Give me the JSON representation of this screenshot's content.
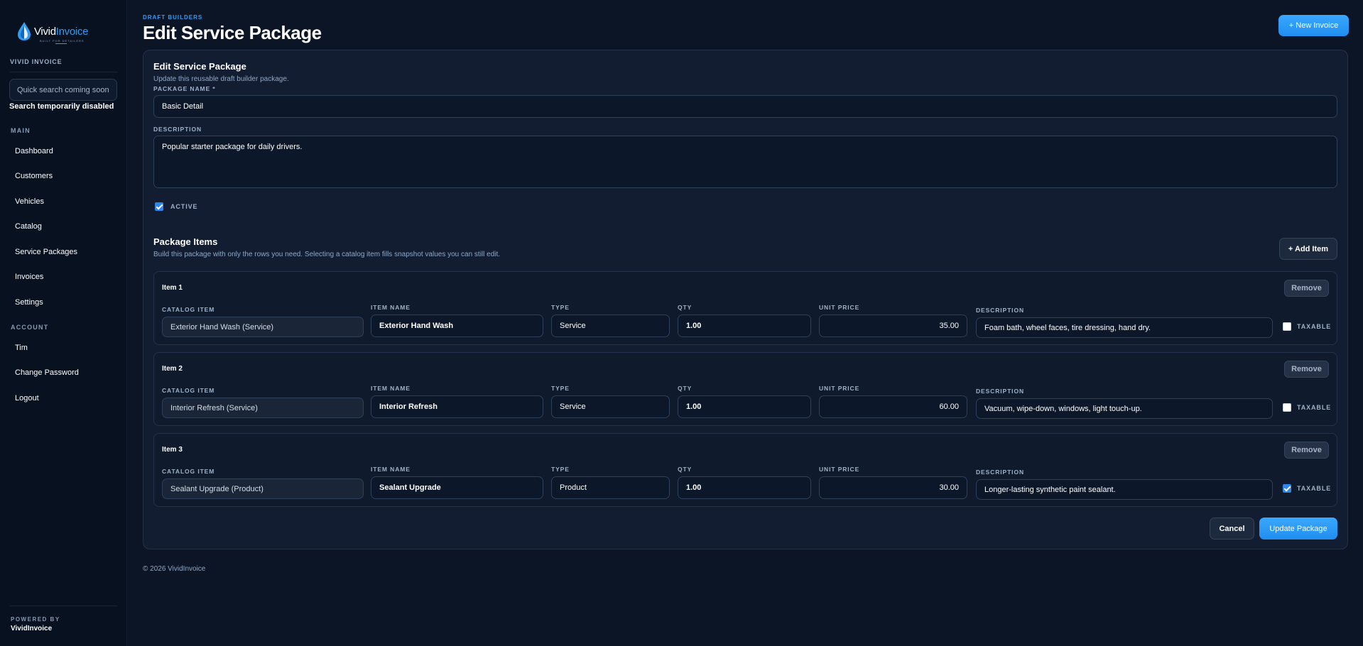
{
  "brand": {
    "logo_name": "Vivid",
    "logo_accent": "Invoice",
    "logo_tagline": "BUILT FOR DETAILERS",
    "label": "VIVID INVOICE"
  },
  "search": {
    "placeholder": "Quick search coming soon",
    "note": "Search temporarily disabled"
  },
  "nav": {
    "main_label": "MAIN",
    "main_items": [
      "Dashboard",
      "Customers",
      "Vehicles",
      "Catalog",
      "Service Packages",
      "Invoices",
      "Settings"
    ],
    "account_label": "ACCOUNT",
    "account_items": [
      "Tim",
      "Change Password",
      "Logout"
    ]
  },
  "powered": {
    "label": "POWERED BY",
    "brand": "VividInvoice"
  },
  "header": {
    "eyebrow": "DRAFT BUILDERS",
    "title": "Edit Service Package",
    "new_invoice_label": "+ New Invoice"
  },
  "form": {
    "title": "Edit Service Package",
    "subtitle": "Update this reusable draft builder package.",
    "name_label": "PACKAGE NAME *",
    "name_value": "Basic Detail",
    "description_label": "DESCRIPTION",
    "description_value": "Popular starter package for daily drivers.",
    "active_label": "ACTIVE",
    "active": true
  },
  "items_section": {
    "title": "Package Items",
    "subtitle": "Build this package with only the rows you need. Selecting a catalog item fills snapshot values you can still edit.",
    "add_item_label": "+ Add Item",
    "remove_label": "Remove",
    "labels": {
      "catalog": "CATALOG ITEM",
      "name": "ITEM NAME",
      "type": "TYPE",
      "qty": "QTY",
      "price": "UNIT PRICE",
      "description": "DESCRIPTION",
      "taxable": "TAXABLE"
    },
    "items": [
      {
        "title": "Item 1",
        "catalog": "Exterior Hand Wash (Service)",
        "name": "Exterior Hand Wash",
        "type": "Service",
        "qty": "1.00",
        "price": "35.00",
        "description": "Foam bath, wheel faces, tire dressing, hand dry.",
        "taxable": false
      },
      {
        "title": "Item 2",
        "catalog": "Interior Refresh (Service)",
        "name": "Interior Refresh",
        "type": "Service",
        "qty": "1.00",
        "price": "60.00",
        "description": "Vacuum, wipe-down, windows, light touch-up.",
        "taxable": false
      },
      {
        "title": "Item 3",
        "catalog": "Sealant Upgrade (Product)",
        "name": "Sealant Upgrade",
        "type": "Product",
        "qty": "1.00",
        "price": "30.00",
        "description": "Longer-lasting synthetic paint sealant.",
        "taxable": true
      }
    ]
  },
  "actions": {
    "cancel_label": "Cancel",
    "update_label": "Update Package"
  },
  "footer": {
    "text": "© 2026 VividInvoice"
  },
  "colors": {
    "accent": "#2f9cf4",
    "background": "#0b1526",
    "sidebar": "#081120"
  }
}
